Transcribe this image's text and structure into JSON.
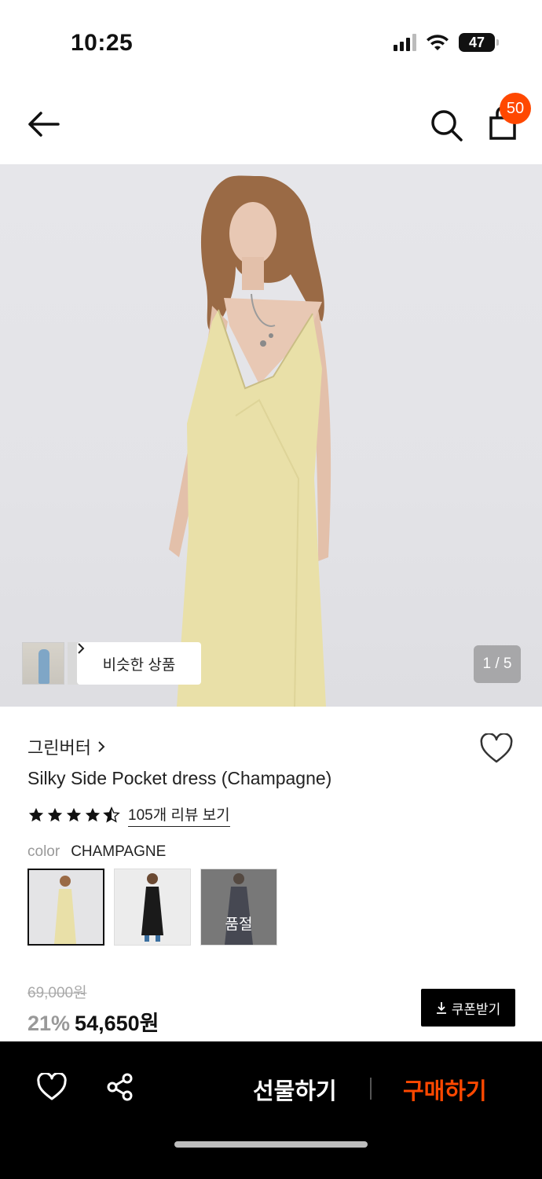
{
  "status": {
    "time": "10:25",
    "battery": "47"
  },
  "header": {
    "back_icon": "arrow-left-icon",
    "search_icon": "search-icon",
    "cart_icon": "shopping-bag-icon",
    "cart_count": "50",
    "accent": "#ff4800"
  },
  "gallery": {
    "similar_label": "비슷한 상품",
    "page_indicator": "1 / 5"
  },
  "product": {
    "brand": "그린버터",
    "name": "Silky Side Pocket dress (Champagne)",
    "rating": 4.5,
    "review_label": "105개 리뷰 보기",
    "color_label": "color",
    "color_value": "CHAMPAGNE",
    "swatches": [
      {
        "name": "CHAMPAGNE",
        "selected": true,
        "sold_out": false,
        "color": "#e8dfa6"
      },
      {
        "name": "BLACK",
        "selected": false,
        "sold_out": false,
        "color": "#1a1a1a"
      },
      {
        "name": "NAVY",
        "selected": false,
        "sold_out": true,
        "sold_label": "품절",
        "color": "#3a3f55"
      }
    ],
    "original_price": "69,000원",
    "discount": "21%",
    "price": "54,650원",
    "coupon_label": "쿠폰받기"
  },
  "bottom_bar": {
    "gift_label": "선물하기",
    "buy_label": "구매하기",
    "buy_color": "#ff4800"
  }
}
